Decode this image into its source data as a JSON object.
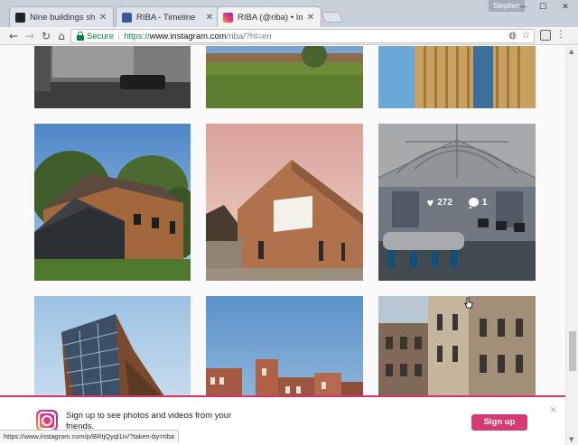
{
  "browser": {
    "profile_name": "Stephen",
    "tabs": [
      {
        "title": "Nine buildings shortliste",
        "favicon_color": "#222222",
        "active": false
      },
      {
        "title": "RIBA - Timeline",
        "favicon_color": "#3b5998",
        "active": false
      },
      {
        "title": "RIBA (@riba) • Instagram",
        "favicon_color": "#d6336c",
        "active": true
      }
    ],
    "tab_close_icon": "close-icon",
    "security_label": "Secure",
    "url_scheme": "https://",
    "url_host": "www.instagram.com",
    "url_path": "/riba/?hl=en"
  },
  "grid": {
    "hovered_post": {
      "likes": "272",
      "comments": "1"
    }
  },
  "banner": {
    "message": "Sign up to see photos and videos from your friends.",
    "signup_label": "Sign up",
    "close_label": "×"
  },
  "status_bar": {
    "link": "https://www.instagram.com/p/BRtjQyql1iv/?taken-by=riba"
  },
  "colors": {
    "accent": "#d63a72",
    "secure_green": "#0b8043"
  }
}
